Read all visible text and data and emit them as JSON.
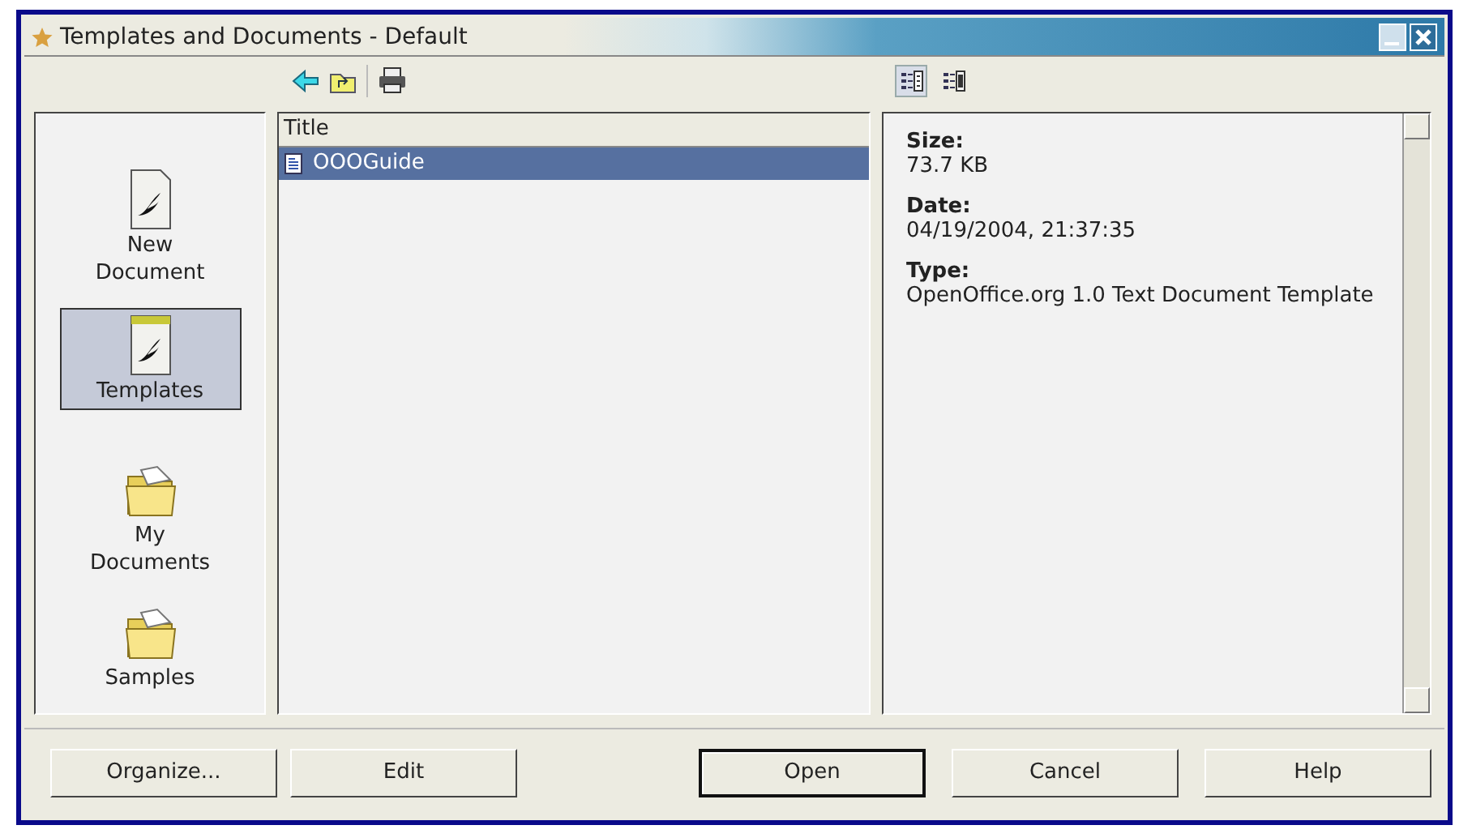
{
  "window": {
    "title": "Templates and Documents - Default"
  },
  "preview_modes": [
    {
      "kind": "details",
      "selected": true
    },
    {
      "kind": "preview",
      "selected": false
    }
  ],
  "categories": [
    {
      "label": "New Document",
      "kind": "document",
      "selected": false
    },
    {
      "label": "Templates",
      "kind": "template",
      "selected": true
    },
    {
      "label": "My Documents",
      "kind": "folder",
      "selected": false
    },
    {
      "label": "Samples",
      "kind": "folder",
      "selected": false
    }
  ],
  "list": {
    "columns": [
      "Title"
    ],
    "items": [
      {
        "name": "OOOGuide",
        "selected": true
      }
    ]
  },
  "info": [
    {
      "label": "Size:",
      "value": "73.7 KB"
    },
    {
      "label": "Date:",
      "value": "04/19/2004, 21:37:35"
    },
    {
      "label": "Type:",
      "value": "OpenOffice.org  1.0 Text Document Template"
    }
  ],
  "buttons": [
    {
      "label": "Organize...",
      "default": false
    },
    {
      "label": "Edit",
      "default": false
    },
    {
      "label": "Open",
      "default": true
    },
    {
      "label": "Cancel",
      "default": false
    },
    {
      "label": "Help",
      "default": false
    }
  ]
}
